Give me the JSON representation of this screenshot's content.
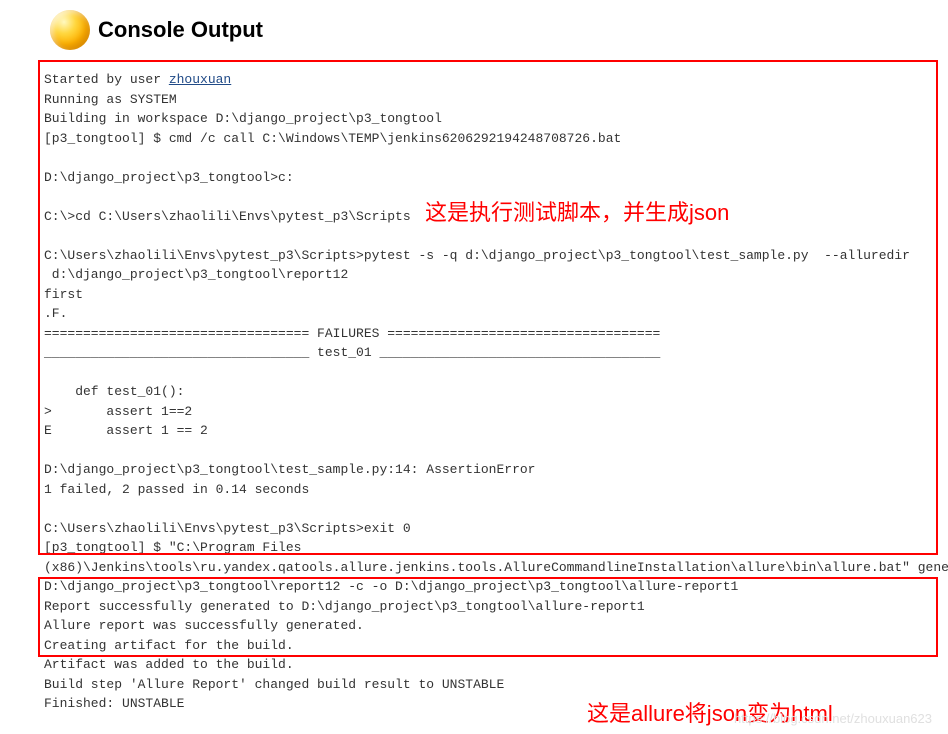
{
  "header": {
    "title": "Console Output"
  },
  "user": {
    "name": "zhouxuan"
  },
  "console": {
    "line1_prefix": "Started by user ",
    "line2": "Running as SYSTEM",
    "line3": "Building in workspace D:\\django_project\\p3_tongtool",
    "line4": "[p3_tongtool] $ cmd /c call C:\\Windows\\TEMP\\jenkins6206292194248708726.bat",
    "blank": "",
    "line5": "D:\\django_project\\p3_tongtool>c:",
    "line6": "C:\\>cd C:\\Users\\zhaolili\\Envs\\pytest_p3\\Scripts",
    "line7": "C:\\Users\\zhaolili\\Envs\\pytest_p3\\Scripts>pytest -s -q d:\\django_project\\p3_tongtool\\test_sample.py  --alluredir",
    "line8": " d:\\django_project\\p3_tongtool\\report12",
    "line9": "first",
    "line10": ".F.",
    "line11": "================================== FAILURES ===================================",
    "line12": "__________________________________ test_01 ____________________________________",
    "line13": "    def test_01():",
    "line14": ">       assert 1==2",
    "line15": "E       assert 1 == 2",
    "line16": "D:\\django_project\\p3_tongtool\\test_sample.py:14: AssertionError",
    "line17": "1 failed, 2 passed in 0.14 seconds",
    "line18": "C:\\Users\\zhaolili\\Envs\\pytest_p3\\Scripts>exit 0 ",
    "line19": "[p3_tongtool] $ \"C:\\Program Files ",
    "line20": "(x86)\\Jenkins\\tools\\ru.yandex.qatools.allure.jenkins.tools.AllureCommandlineInstallation\\allure\\bin\\allure.bat\" generate ",
    "line21": "D:\\django_project\\p3_tongtool\\report12 -c -o D:\\django_project\\p3_tongtool\\allure-report1",
    "line22": "Report successfully generated to D:\\django_project\\p3_tongtool\\allure-report1",
    "line23": "Allure report was successfully generated.",
    "line24": "Creating artifact for the build.",
    "line25": "Artifact was added to the build.",
    "line26": "Build step 'Allure Report' changed build result to UNSTABLE",
    "line27": "Finished: UNSTABLE"
  },
  "annotations": {
    "a1": "这是执行测试脚本，并生成json",
    "a2": "这是allure将json变为html"
  },
  "watermark": "https://blog.csdn.net/zhouxuan623"
}
